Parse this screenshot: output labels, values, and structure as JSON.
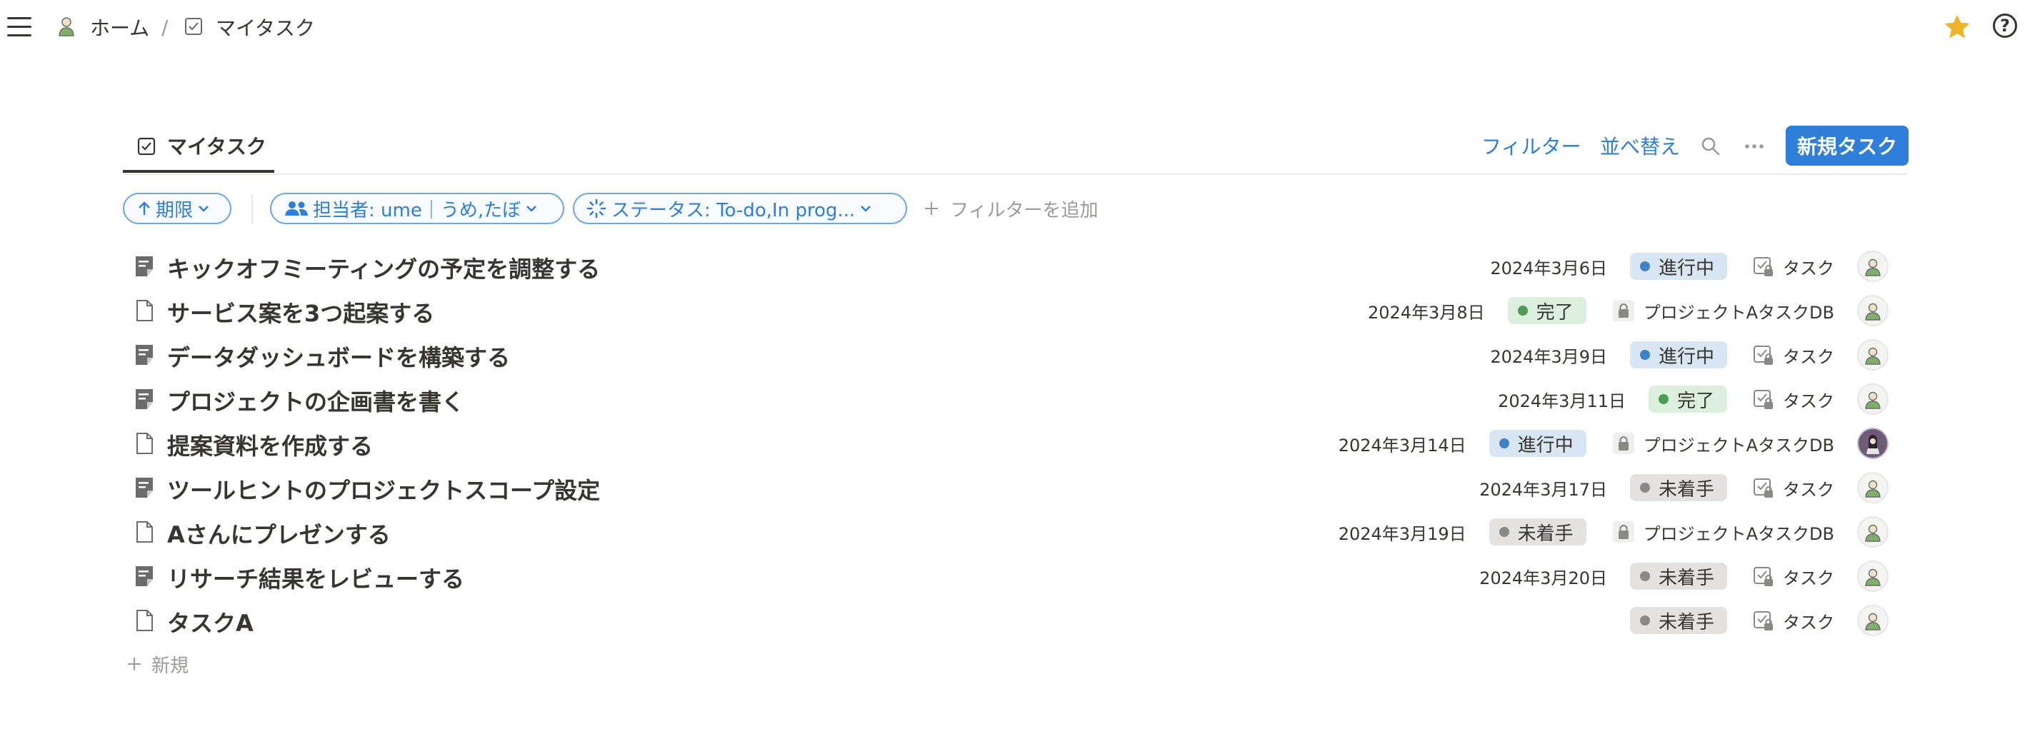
{
  "breadcrumb": {
    "home": "ホーム",
    "separator": "/",
    "page": "マイタスク"
  },
  "icons": {
    "menu": "hamburger-icon",
    "home": "person-icon",
    "page": "checkbox-icon",
    "favorite": "star-icon",
    "help": "question-icon"
  },
  "view": {
    "tab_label": "マイタスク",
    "filter_label": "フィルター",
    "sort_label": "並べ替え",
    "new_task_label": "新規タスク"
  },
  "filters": {
    "due": "期限",
    "assignee": "担当者: ume｜うめ,たぼ",
    "status": "ステータス: To-do,In prog...",
    "add": "フィルターを追加"
  },
  "colors": {
    "accent": "#2f7ed8",
    "in_progress": "#3f83c6",
    "done": "#4c9a57",
    "not_started": "#8a8986",
    "star": "#f0b429"
  },
  "tasks": [
    {
      "title": "キックオフミーティングの予定を調整する",
      "icon": "page-with-content-icon",
      "date": "2024年3月6日",
      "status": "進行中",
      "status_type": "prog",
      "relation": "タスク",
      "relation_icon": "checkbox-lock-icon",
      "avatar": "light"
    },
    {
      "title": "サービス案を3つ起案する",
      "icon": "blank-page-icon",
      "date": "2024年3月8日",
      "status": "完了",
      "status_type": "done",
      "relation": "プロジェクトAタスクDB",
      "relation_icon": "lock-icon",
      "avatar": "light"
    },
    {
      "title": "データダッシュボードを構築する",
      "icon": "page-with-content-icon",
      "date": "2024年3月9日",
      "status": "進行中",
      "status_type": "prog",
      "relation": "タスク",
      "relation_icon": "checkbox-lock-icon",
      "avatar": "light"
    },
    {
      "title": "プロジェクトの企画書を書く",
      "icon": "page-with-content-icon",
      "date": "2024年3月11日",
      "status": "完了",
      "status_type": "done",
      "relation": "タスク",
      "relation_icon": "checkbox-lock-icon",
      "avatar": "light"
    },
    {
      "title": "提案資料を作成する",
      "icon": "blank-page-icon",
      "date": "2024年3月14日",
      "status": "進行中",
      "status_type": "prog",
      "relation": "プロジェクトAタスクDB",
      "relation_icon": "lock-icon",
      "avatar": "dark"
    },
    {
      "title": "ツールヒントのプロジェクトスコープ設定",
      "icon": "page-with-content-icon",
      "date": "2024年3月17日",
      "status": "未着手",
      "status_type": "todo",
      "relation": "タスク",
      "relation_icon": "checkbox-lock-icon",
      "avatar": "light"
    },
    {
      "title": "Aさんにプレゼンする",
      "icon": "blank-page-icon",
      "date": "2024年3月19日",
      "status": "未着手",
      "status_type": "todo",
      "relation": "プロジェクトAタスクDB",
      "relation_icon": "lock-icon",
      "avatar": "light"
    },
    {
      "title": "リサーチ結果をレビューする",
      "icon": "page-with-content-icon",
      "date": "2024年3月20日",
      "status": "未着手",
      "status_type": "todo",
      "relation": "タスク",
      "relation_icon": "checkbox-lock-icon",
      "avatar": "light"
    },
    {
      "title": "タスクA",
      "icon": "blank-page-icon",
      "date": "",
      "status": "未着手",
      "status_type": "todo",
      "relation": "タスク",
      "relation_icon": "checkbox-lock-icon",
      "avatar": "light"
    }
  ],
  "new_row_label": "新規"
}
